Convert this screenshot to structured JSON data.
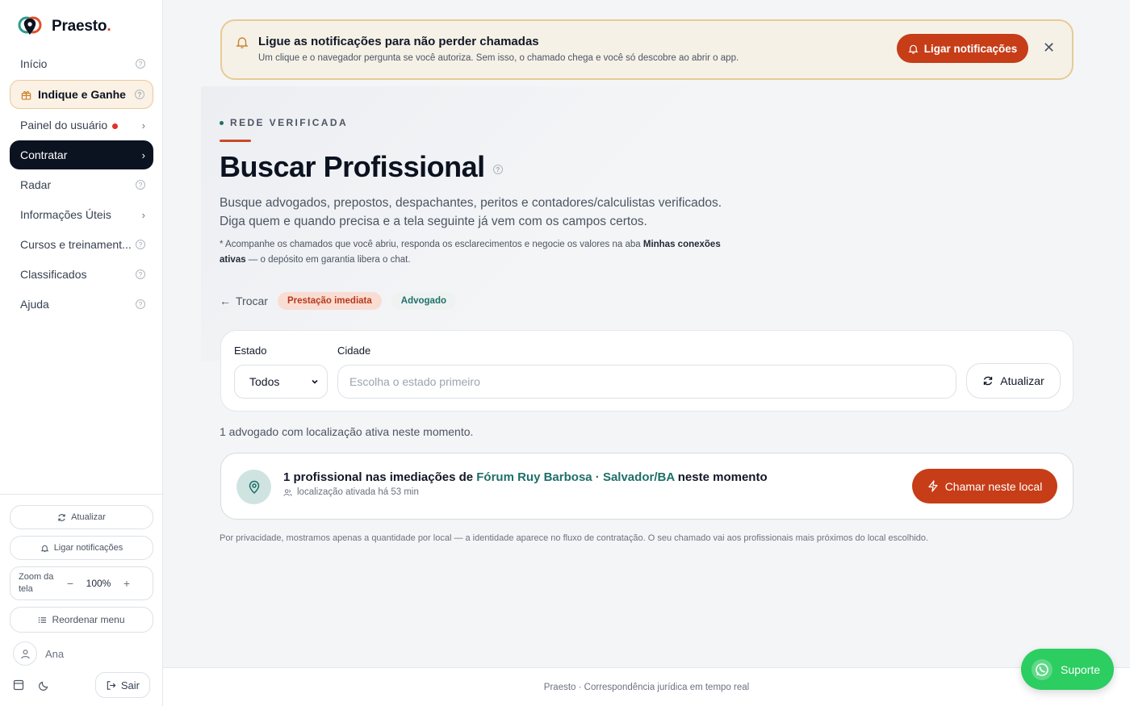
{
  "brand": {
    "name": "Praesto",
    "dot": "."
  },
  "sidebar": {
    "items": [
      {
        "label": "Início"
      },
      {
        "label": "Indique e Ganhe"
      },
      {
        "label": "Painel do usuário"
      },
      {
        "label": "Contratar"
      },
      {
        "label": "Radar"
      },
      {
        "label": "Informações Úteis"
      },
      {
        "label": "Cursos e treinament..."
      },
      {
        "label": "Classificados"
      },
      {
        "label": "Ajuda"
      }
    ],
    "refresh_label": "Atualizar",
    "notify_label": "Ligar notificações",
    "zoom_label": "Zoom da tela",
    "zoom_value": "100%",
    "reorder_label": "Reordenar menu",
    "user_name": "Ana",
    "logout_label": "Sair"
  },
  "notification": {
    "title": "Ligue as notificações para não perder chamadas",
    "subtitle": "Um clique e o navegador pergunta se você autoriza. Sem isso, o chamado chega e você só descobre ao abrir o app.",
    "button": "Ligar notificações"
  },
  "hero": {
    "eyebrow": "REDE VERIFICADA",
    "title": "Buscar Profissional",
    "desc1": "Busque advogados, prepostos, despachantes, peritos e contadores/calculistas verificados.",
    "desc2": "Diga quem e quando precisa e a tela seguinte já vem com os campos certos.",
    "note_pre": "* Acompanhe os chamados que você abriu, responda os esclarecimentos e negocie os valores na aba ",
    "note_bold": "Minhas conexões ativas",
    "note_post": " — o depósito em garantia libera o chat."
  },
  "chips": {
    "back": "Trocar",
    "mode": "Prestação imediata",
    "type": "Advogado"
  },
  "filters": {
    "state_label": "Estado",
    "state_value": "Todos",
    "city_label": "Cidade",
    "city_placeholder": "Escolha o estado primeiro",
    "refresh": "Atualizar"
  },
  "count_text": "1 advogado com localização ativa neste momento.",
  "result": {
    "pre": "1 profissional nas imediações de ",
    "location": "Fórum Ruy Barbosa · Salvador/BA",
    "post": " neste momento",
    "sub": "localização ativada há 53 min",
    "button": "Chamar neste local"
  },
  "privacy": "Por privacidade, mostramos apenas a quantidade por local — a identidade aparece no fluxo de contratação. O seu chamado vai aos profissionais mais próximos do local escolhido.",
  "footer": "Praesto · Correspondência jurídica em tempo real",
  "support": "Suporte",
  "colors": {
    "accent": "#c63d18",
    "dark": "#0b1220",
    "teal": "#1f6f6a",
    "whatsapp": "#2ccd61"
  }
}
